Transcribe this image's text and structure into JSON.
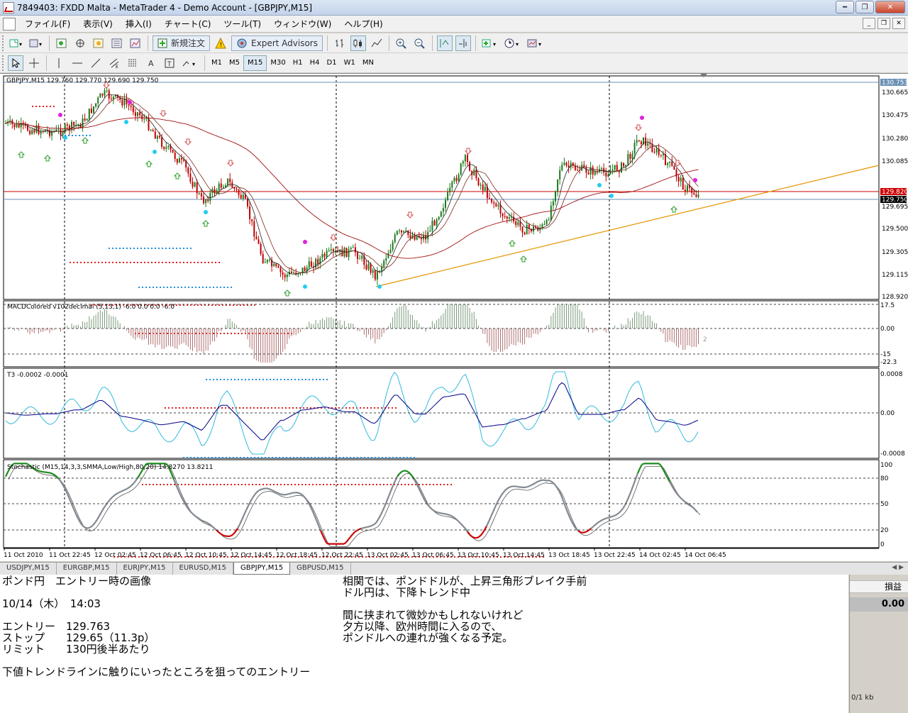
{
  "window": {
    "title": "7849403: FXDD Malta - MetaTrader 4 - Demo Account - [GBPJPY,M15]"
  },
  "menu": [
    "ファイル(F)",
    "表示(V)",
    "挿入(I)",
    "チャート(C)",
    "ツール(T)",
    "ウィンドウ(W)",
    "ヘルプ(H)"
  ],
  "toolbar": {
    "new_order": "新規注文",
    "expert_advisors": "Expert Advisors"
  },
  "timeframes": [
    "M1",
    "M5",
    "M15",
    "M30",
    "H1",
    "H4",
    "D1",
    "W1",
    "MN"
  ],
  "active_timeframe": "M15",
  "chart": {
    "header": "GBPJPY,M15  129.760 129.770 129.690 129.750",
    "price_ticks": [
      "130.753",
      "130.665",
      "130.475",
      "130.280",
      "130.085",
      "129.820",
      "129.750",
      "129.695",
      "129.500",
      "129.305",
      "129.115",
      "128.920"
    ],
    "macd_label": "MACDColored v102decimal (5,13,1) -6.0 0.0 0.0 -6.0",
    "macd_ticks": [
      "17.5",
      "0.00",
      "-15",
      "-22.3"
    ],
    "macd_tag": "2",
    "t3_label": "T3 -0.0002 -0.0001",
    "t3_ticks": [
      "0.0008",
      "0.00",
      "-0.0008"
    ],
    "stoch_label": "Stochastic (M15,14,3,3,SMMA,Low/High,80,20) 14.8270 13.8211",
    "stoch_ticks": [
      "100",
      "80",
      "50",
      "20",
      "0"
    ],
    "time_labels": [
      "11 Oct 2010",
      "11 Oct 22:45",
      "12 Oct 02:45",
      "12 Oct 06:45",
      "12 Oct 10:45",
      "12 Oct 14:45",
      "12 Oct 18:45",
      "12 Oct 22:45",
      "13 Oct 02:45",
      "13 Oct 06:45",
      "13 Oct 10:45",
      "13 Oct 14:45",
      "13 Oct 18:45",
      "13 Oct 22:45",
      "14 Oct 02:45",
      "14 Oct 06:45"
    ],
    "colors": {
      "bull": "#1a7a1a",
      "bear": "#c00000",
      "price_line": "#cc0000",
      "trendline": "#e69500",
      "stoch_high": "#1a8a1a",
      "stoch_low": "#cc0000",
      "stoch_mid": "#808890",
      "t3_fast": "#33bbdd",
      "t3_slow": "#000088"
    }
  },
  "symbol_tabs": [
    "USDJPY,M15",
    "EURGBP,M15",
    "EURJPY,M15",
    "EURUSD,M15",
    "GBPJPY,M15",
    "GBPUSD,M15"
  ],
  "active_symbol_tab": "GBPJPY,M15",
  "notes": {
    "left": [
      "ポンド円　エントリー時の画像",
      "",
      "10/14（木）　14:03",
      "",
      "エントリー　129.763",
      "ストップ　　129.65（11.3p）",
      "リミット　　130円後半あたり",
      "",
      "下値トレンドラインに触りにいったところを狙ってのエントリー"
    ],
    "right": [
      "相関では、ポンドドルが、上昇三角形ブレイク手前",
      "ドル円は、下降トレンド中",
      "",
      "間に挟まれて微妙かもしれないけれど",
      "夕方以降、欧州時間に入るので、",
      "ポンドルへの連れが強くなる予定。"
    ]
  },
  "side_panel": {
    "header": "損益",
    "value": "0.00",
    "status": "0/1 kb"
  }
}
